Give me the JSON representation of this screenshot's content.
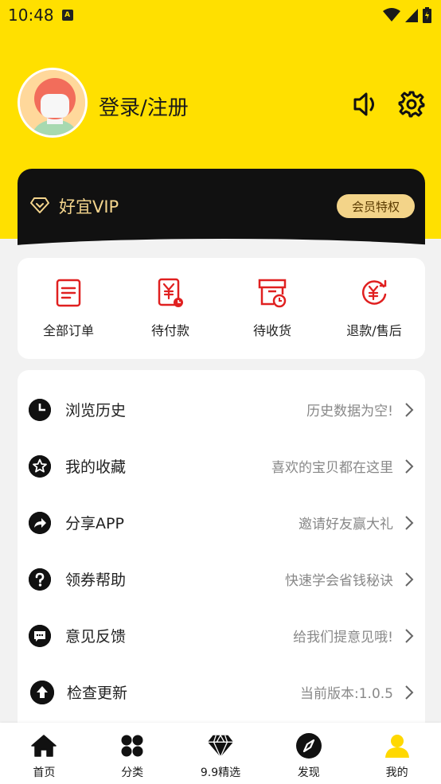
{
  "status_bar": {
    "time": "10:48"
  },
  "header": {
    "login_text": "登录/注册"
  },
  "vip": {
    "label": "好宜VIP",
    "badge": "会员特权"
  },
  "orders": [
    {
      "label": "全部订单",
      "icon": "order-list-icon"
    },
    {
      "label": "待付款",
      "icon": "pending-payment-icon"
    },
    {
      "label": "待收货",
      "icon": "pending-receipt-icon"
    },
    {
      "label": "退款/售后",
      "icon": "refund-icon"
    }
  ],
  "menu": [
    {
      "title": "浏览历史",
      "hint": "历史数据为空!",
      "icon": "clock-icon"
    },
    {
      "title": "我的收藏",
      "hint": "喜欢的宝贝都在这里",
      "icon": "star-icon"
    },
    {
      "title": "分享APP",
      "hint": "邀请好友赢大礼",
      "icon": "share-icon"
    },
    {
      "title": "领券帮助",
      "hint": "快速学会省钱秘诀",
      "icon": "help-icon"
    },
    {
      "title": "意见反馈",
      "hint": "给我们提意见哦!",
      "icon": "feedback-icon"
    },
    {
      "title": "检查更新",
      "hint": "当前版本:1.0.5",
      "icon": "upload-icon"
    }
  ],
  "tabs": [
    {
      "label": "首页",
      "icon": "home-icon"
    },
    {
      "label": "分类",
      "icon": "category-icon"
    },
    {
      "label": "9.9精选",
      "icon": "diamond-icon"
    },
    {
      "label": "发现",
      "icon": "compass-icon"
    },
    {
      "label": "我的",
      "icon": "user-icon"
    }
  ],
  "colors": {
    "brand_yellow": "#ffe000",
    "accent_red": "#e02020",
    "vip_gold": "#f3d489"
  }
}
